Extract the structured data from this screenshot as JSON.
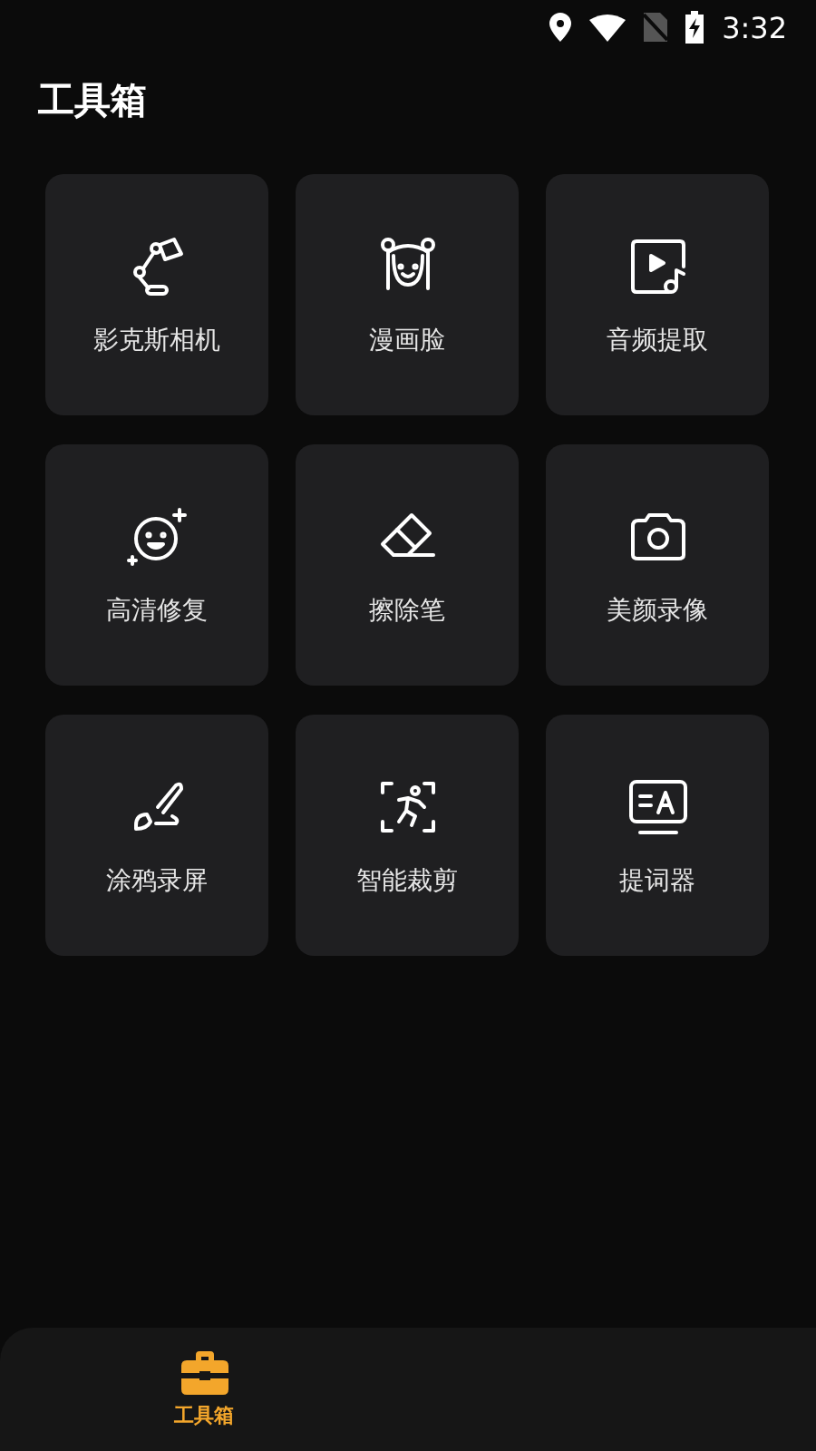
{
  "status_bar": {
    "time": "3:32"
  },
  "title": "工具箱",
  "tools": [
    {
      "kind": "lamp",
      "label": "影克斯相机"
    },
    {
      "kind": "girl",
      "label": "漫画脸"
    },
    {
      "kind": "audio",
      "label": "音频提取"
    },
    {
      "kind": "smile",
      "label": "高清修复"
    },
    {
      "kind": "eraser",
      "label": "擦除笔"
    },
    {
      "kind": "camera",
      "label": "美颜录像"
    },
    {
      "kind": "brush",
      "label": "涂鸦录屏"
    },
    {
      "kind": "runner",
      "label": "智能裁剪"
    },
    {
      "kind": "prompter",
      "label": "提词器"
    }
  ],
  "bottom_nav": [
    {
      "label": "工具箱",
      "selected": true
    }
  ]
}
